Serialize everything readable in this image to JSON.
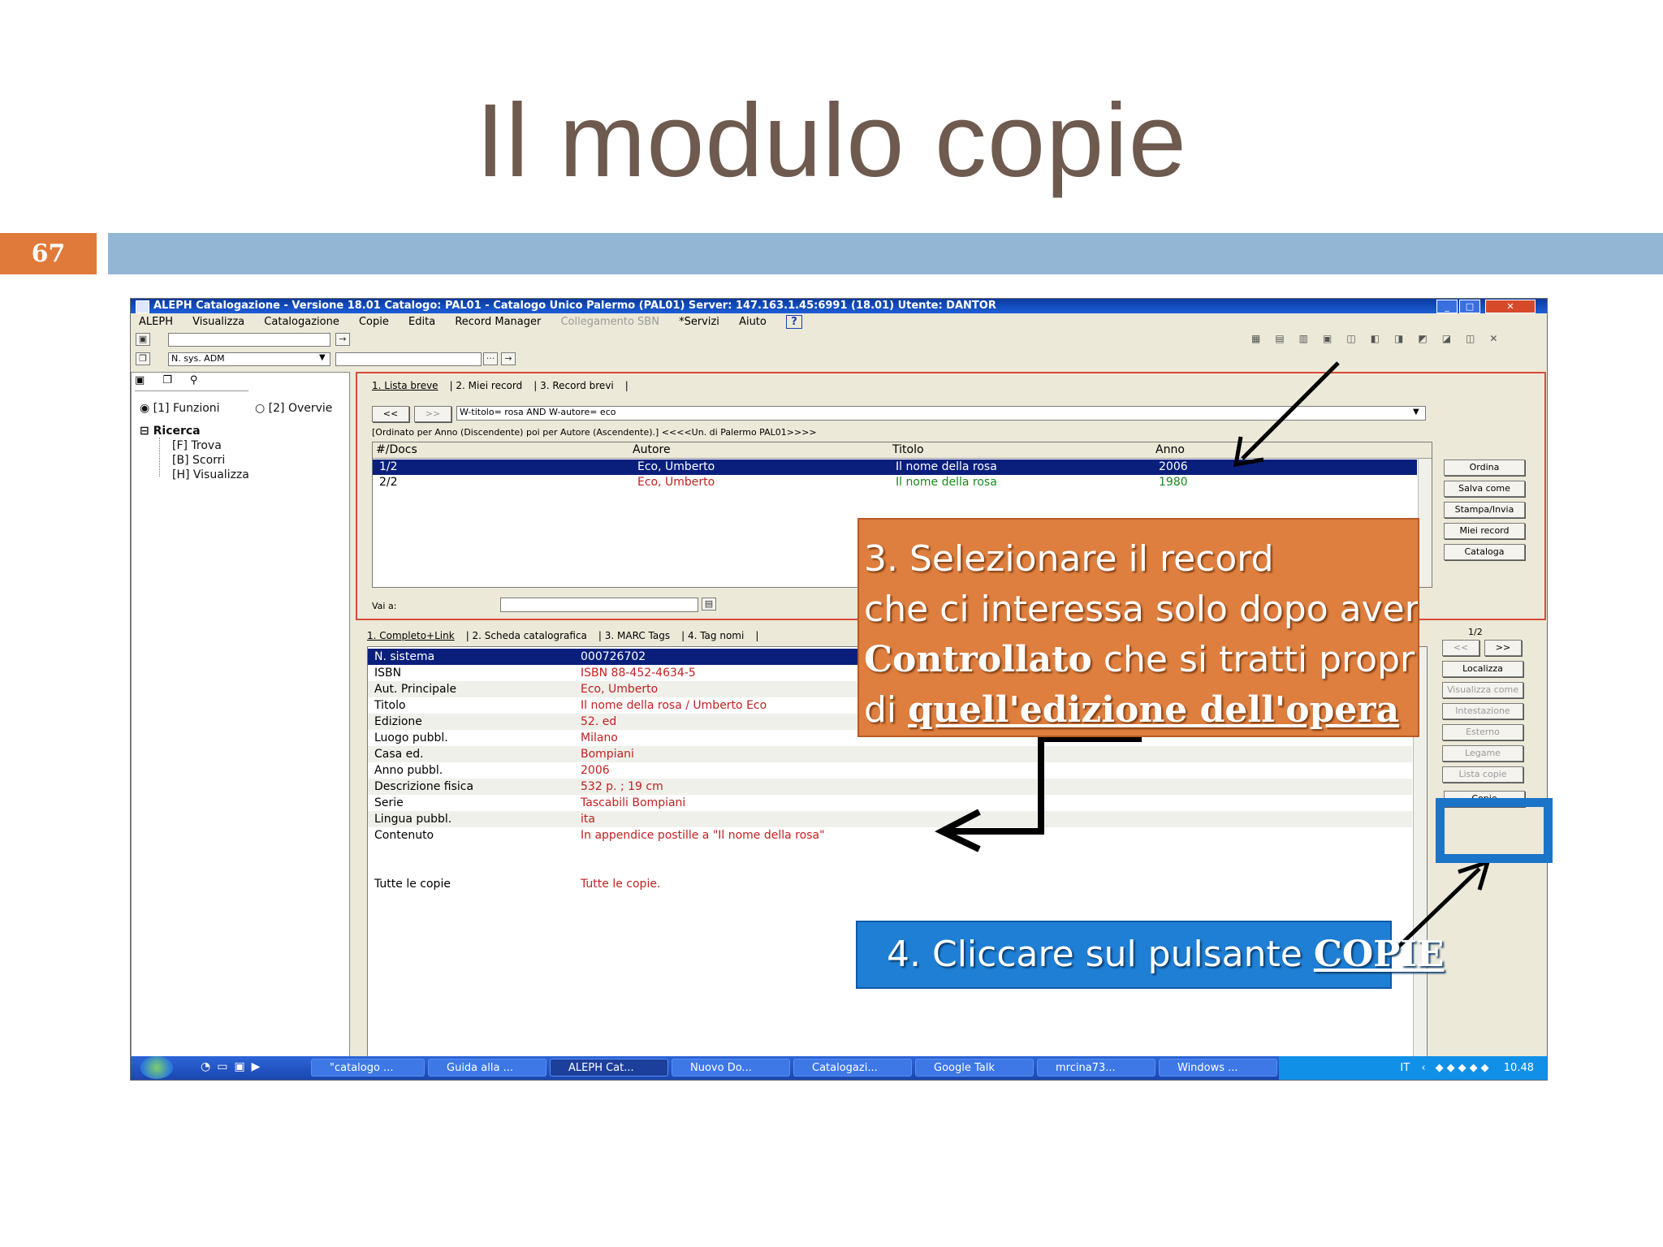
{
  "slide": {
    "title": "Il modulo copie",
    "page_number": "67"
  },
  "window": {
    "title": "ALEPH Catalogazione - Versione 18.01  Catalogo:  PAL01 - Catalogo Unico Palermo (PAL01)  Server:  147.163.1.45:6991 (18.01)  Utente:  DANTOR",
    "controls": [
      "_",
      "□",
      "✕"
    ],
    "menu": [
      "ALEPH",
      "Visualizza",
      "Catalogazione",
      "Copie",
      "Edita",
      "Record Manager",
      "Collegamento SBN",
      "*Servizi",
      "Aiuto"
    ],
    "help_icon": "?",
    "search_type": "N. sys. ADM",
    "browse_icon": "···"
  },
  "left_panel": {
    "radio_1": "[1] Funzioni",
    "radio_2": "[2] Overvie",
    "tree_root": "Ricerca",
    "tree_items": [
      "[F] Trova",
      "[B] Scorri",
      "[H] Visualizza"
    ]
  },
  "results": {
    "tabs": [
      "1. Lista breve",
      "2. Miei record",
      "3. Record brevi"
    ],
    "prev_label": "<<",
    "next_label": ">>",
    "query": "W-titolo= rosa AND W-autore= eco",
    "sort_info": "[Ordinato per Anno (Discendente) poi per Autore (Ascendente).]   <<<<Un. di Palermo PAL01>>>>",
    "columns": [
      "#/Docs",
      "Autore",
      "Titolo",
      "Anno"
    ],
    "rows": [
      {
        "doc": "1/2",
        "autore": "Eco, Umberto",
        "titolo": "Il nome della rosa",
        "anno": "2006"
      },
      {
        "doc": "2/2",
        "autore": "Eco, Umberto",
        "titolo": "Il nome della rosa",
        "anno": "1980"
      }
    ],
    "goto_label": "Vai a:",
    "buttons": [
      "Ordina",
      "Salva come",
      "Stampa/Invia",
      "Miei record",
      "Cataloga"
    ]
  },
  "detail": {
    "tabs": [
      "1. Completo+Link",
      "2. Scheda catalografica",
      "3. MARC Tags",
      "4. Tag nomi"
    ],
    "counter": "1/2",
    "rows": [
      {
        "label": "N. sistema",
        "value": "000726702"
      },
      {
        "label": "ISBN",
        "value": "ISBN 88-452-4634-5"
      },
      {
        "label": "Aut. Principale",
        "value": "Eco, Umberto"
      },
      {
        "label": "Titolo",
        "value": "Il nome della rosa / Umberto Eco"
      },
      {
        "label": "Edizione",
        "value": "52. ed"
      },
      {
        "label": "Luogo pubbl.",
        "value": "Milano"
      },
      {
        "label": "Casa ed.",
        "value": "Bompiani"
      },
      {
        "label": "Anno pubbl.",
        "value": "2006"
      },
      {
        "label": "Descrizione fisica",
        "value": "532 p. ; 19 cm"
      },
      {
        "label": "Serie",
        "value": "Tascabili Bompiani"
      },
      {
        "label": "Lingua pubbl.",
        "value": "ita"
      },
      {
        "label": "Contenuto",
        "value": "In appendice postille a \"Il nome della rosa\""
      }
    ],
    "copies_label": "Tutte le copie",
    "copies_value": "Tutte le copie.",
    "buttons": [
      "Localizza",
      "Visualizza come",
      "Intestazione",
      "Esterno",
      "Legame",
      "Lista copie"
    ],
    "copie_button": "Copie"
  },
  "taskbar": {
    "items": [
      "\"catalogo ...",
      "Guida alla ...",
      "ALEPH Cat...",
      "Nuovo Do...",
      "Catalogazi...",
      "Google Talk",
      "mrcina73...",
      "Windows ..."
    ],
    "lang": "IT",
    "clock": "10.48"
  },
  "callouts": {
    "orange_lines": [
      "3. Selezionare il record",
      "che ci interessa solo dopo aver"
    ],
    "orange_bold": "Controllato",
    "orange_rest": " che si tratti proprio",
    "orange_prefix": "di ",
    "orange_underline": "quell'edizione dell'opera",
    "blue_text": "4. Cliccare sul pulsante ",
    "blue_underline": "COPIE"
  },
  "colors": {
    "title": "#6e5a4e",
    "page_number_bg": "#e07a3a",
    "header_bar": "#93b6d5",
    "orange_callout": "#de7f3f",
    "blue_callout": "#1f7fd4",
    "selected_row": "#0a1f7c",
    "value_red": "#c22020",
    "value_green": "#1a8a1a"
  }
}
